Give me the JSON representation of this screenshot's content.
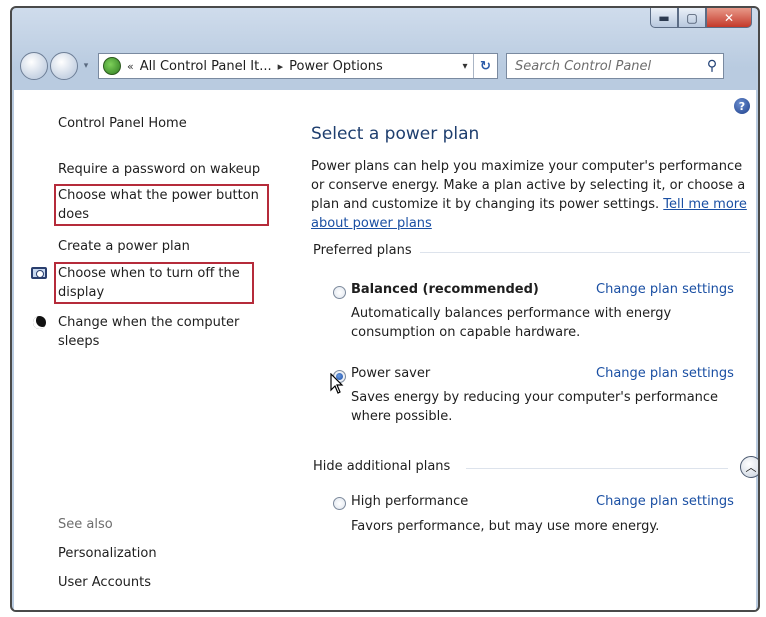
{
  "window": {
    "minimize_icon": "minimize-icon",
    "maximize_icon": "maximize-icon",
    "close_icon": "close-icon",
    "minimize_glyph": "▬",
    "maximize_glyph": "▢",
    "close_glyph": "✕"
  },
  "navigation": {
    "back_glyph": "",
    "forward_glyph": "",
    "address": {
      "chevrons": "«",
      "segments": [
        "All Control Panel It...",
        "Power Options"
      ],
      "separator": "▸",
      "dropdown_glyph": "▾",
      "refresh_glyph": "↻"
    },
    "search": {
      "placeholder": "Search Control Panel",
      "icon_glyph": "⚲"
    }
  },
  "left_pane": {
    "home": "Control Panel Home",
    "tasks": [
      "Require a password on wakeup",
      "Choose what the power button does",
      "Create a power plan",
      "Choose when to turn off the display",
      "Change when the computer sleeps"
    ],
    "see_also_label": "See also",
    "see_also": [
      "Personalization",
      "User Accounts"
    ]
  },
  "main": {
    "help_glyph": "?",
    "title": "Select a power plan",
    "description": "Power plans can help you maximize your computer's performance or conserve energy. Make a plan active by selecting it, or choose a plan and customize it by changing its power settings.",
    "tell_me_more": "Tell me more about power plans",
    "preferred_label": "Preferred plans",
    "plans": [
      {
        "name": "Balanced (recommended)",
        "selected": false,
        "change_label": "Change plan settings",
        "description": "Automatically balances performance with energy consumption on capable hardware."
      },
      {
        "name": "Power saver",
        "selected": true,
        "change_label": "Change plan settings",
        "description": "Saves energy by reducing your computer's performance where possible."
      }
    ],
    "hide_additional_label": "Hide additional plans",
    "collapse_glyph": "︿",
    "additional_plans": [
      {
        "name": "High performance",
        "selected": false,
        "change_label": "Change plan settings",
        "description": "Favors performance, but may use more energy."
      }
    ]
  },
  "colors": {
    "link": "#1a4fa3",
    "highlight_box": "#b52b3a",
    "title": "#1e3e6e"
  }
}
